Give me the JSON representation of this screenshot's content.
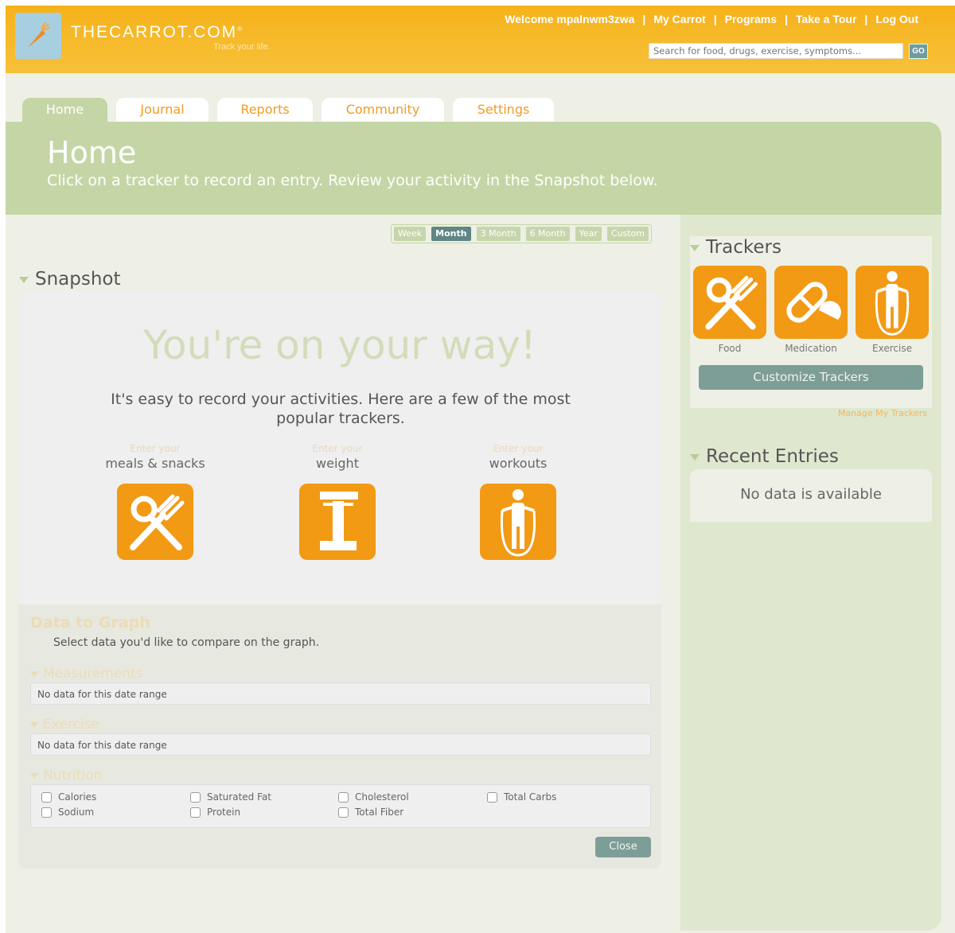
{
  "header": {
    "brand": "THECARROT.COM",
    "brand_mark": "®",
    "tagline": "Track your life.",
    "welcome": "Welcome  mpalnwm3zwa",
    "nav": [
      "My Carrot",
      "Programs",
      "Take a Tour",
      "Log Out"
    ],
    "search_placeholder": "Search for food, drugs, exercise, symptoms...",
    "go_label": "GO"
  },
  "tabs": [
    "Home",
    "Journal",
    "Reports",
    "Community",
    "Settings"
  ],
  "hero": {
    "title": "Home",
    "subtitle": "Click on a tracker to record an entry. Review your activity in the Snapshot below."
  },
  "periods": [
    "Week",
    "Month",
    "3 Month",
    "6 Month",
    "Year",
    "Custom"
  ],
  "active_period": "Month",
  "snapshot": {
    "title": "Snapshot",
    "headline": "You're on your way!",
    "subline": "It's easy to record your activities. Here are a few of the most popular trackers.",
    "quick": [
      {
        "enter": "Enter your",
        "what": "meals & snacks",
        "icon": "food-icon"
      },
      {
        "enter": "Enter your",
        "what": "weight",
        "icon": "scale-icon"
      },
      {
        "enter": "Enter your",
        "what": "workouts",
        "icon": "jump-rope-icon"
      }
    ]
  },
  "graph": {
    "title": "Data to Graph",
    "subtitle": "Select data you'd like to compare on the graph.",
    "measurements_title": "Measurements",
    "measurements_empty": "No data for this date range",
    "exercise_title": "Exercise",
    "exercise_empty": "No data for this date range",
    "nutrition_title": "Nutrition",
    "nutrition_items": [
      "Calories",
      "Saturated Fat",
      "Cholesterol",
      "Total Carbs",
      "Sodium",
      "Protein",
      "Total Fiber"
    ],
    "close_label": "Close"
  },
  "trackers": {
    "title": "Trackers",
    "items": [
      "Food",
      "Medication",
      "Exercise"
    ],
    "customize_label": "Customize Trackers",
    "manage_label": "Manage My Trackers"
  },
  "recent": {
    "title": "Recent Entries",
    "empty": "No data is available"
  },
  "colors": {
    "header_orange": "#f6b21a",
    "tile_orange": "#f29a14",
    "sage": "#c4d6a6",
    "teal_button": "#7d9e97"
  }
}
